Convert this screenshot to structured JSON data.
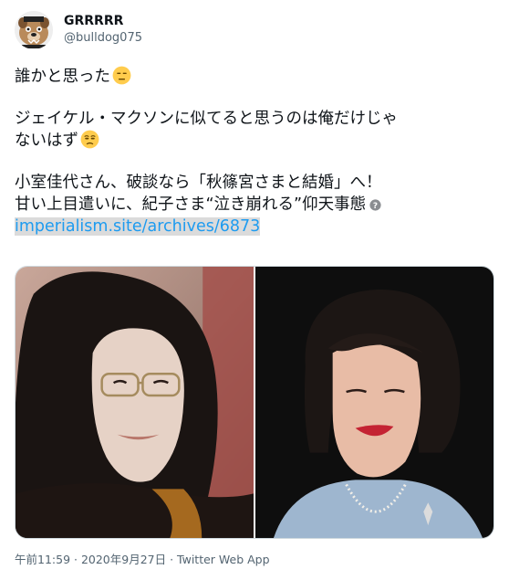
{
  "author": {
    "display_name": "GRRRRR",
    "handle": "@bulldog075",
    "avatar_icon": "bulldog-avatar-icon"
  },
  "tweet": {
    "line1": "誰かと思った",
    "line2": "ジェイケル・マクソンに似てると思うのは俺だけじゃ",
    "line3": "ないはず",
    "line4": "小室佳代さん、破談なら「秋篠宮さまと結婚」へ！",
    "line5": "甘い上目遣いに、紀子さま“泣き崩れる”仰天事態",
    "link_text": "imperialism.site/archives/6873",
    "emoji1": "expressionless-face-emoji",
    "emoji2": "unamused-face-emoji"
  },
  "media": {
    "left_photo": "man-with-long-dark-hair-and-glasses",
    "right_photo": "woman-with-bob-haircut-and-red-lipstick"
  },
  "meta": {
    "timestamp": "午前11:59 · 2020年9月27日 · Twitter Web App"
  },
  "colors": {
    "link": "#1d9bf0",
    "link_highlight": "#dbdbdb",
    "secondary_text": "#536471",
    "primary_text": "#0f1419"
  }
}
